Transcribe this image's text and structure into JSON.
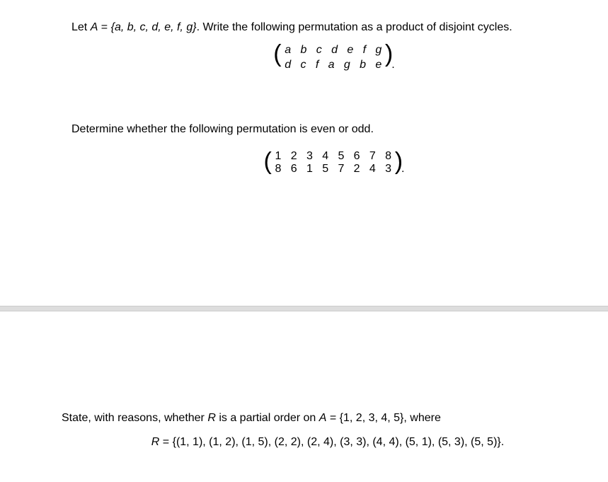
{
  "problem1": {
    "intro_prefix": "Let ",
    "set_label": "A",
    "eq": " = ",
    "set_value": "{a, b, c, d, e, f, g}",
    "intro_suffix": ". Write the following permutation as a product of disjoint cycles.",
    "matrix_top": "a   b   c   d   e   f   g",
    "matrix_bottom": "d   c   f   a   g   b   e",
    "trailing_dot": "."
  },
  "problem2": {
    "prompt": "Determine whether the following permutation is even or odd.",
    "matrix_top": "1   2   3   4   5   6   7   8",
    "matrix_bottom": "8   6   1   5   7   2   4   3",
    "trailing_dot": "."
  },
  "problem3": {
    "prefix": "State, with reasons, whether ",
    "r_label": "R",
    "mid": " is a partial order on ",
    "a_label": "A",
    "eq": " = ",
    "a_set": "{1, 2, 3, 4, 5}",
    "suffix": ", where",
    "r_eq_label": "R",
    "r_eq": " = ",
    "r_set": "{(1, 1), (1, 2), (1, 5), (2, 2), (2, 4), (3, 3), (4, 4), (5, 1), (5, 3), (5, 5)}.",
    "source": {
      "matrix1_map": {
        "a": "d",
        "b": "c",
        "c": "f",
        "d": "a",
        "e": "g",
        "f": "b",
        "g": "e"
      },
      "matrix2_map": {
        "1": 8,
        "2": 6,
        "3": 1,
        "4": 5,
        "5": 7,
        "6": 2,
        "7": 4,
        "8": 3
      }
    }
  }
}
